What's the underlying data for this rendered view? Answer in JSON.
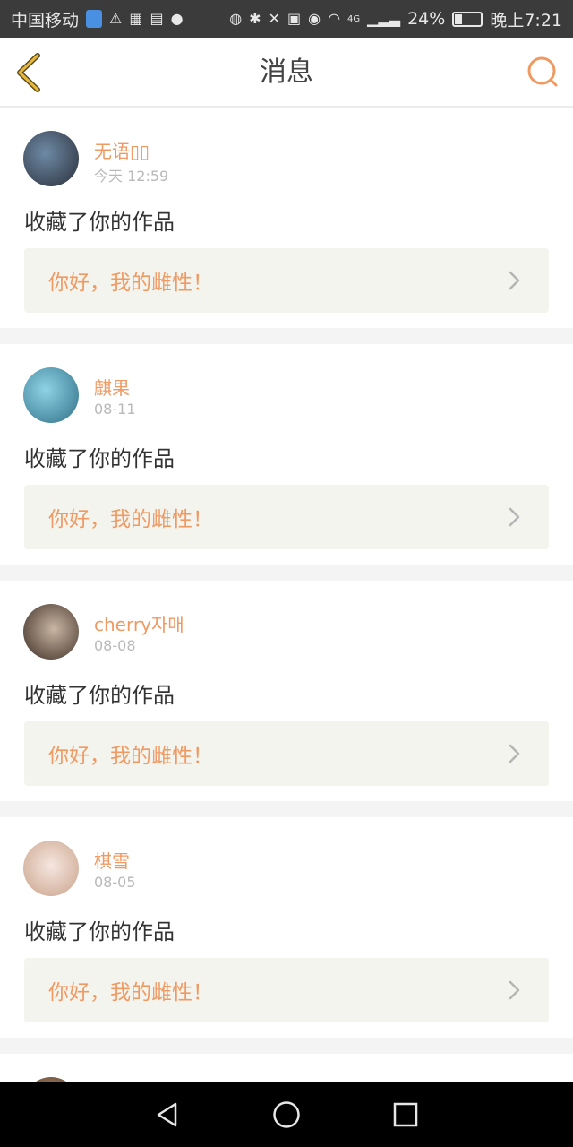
{
  "status_bar": {
    "carrier": "中国移动",
    "battery": "24%",
    "time": "晚上7:21",
    "network": "4G"
  },
  "header": {
    "title": "消息"
  },
  "messages": [
    {
      "name": "无语▯▯",
      "date": "今天 12:59",
      "action": "收藏了你的作品",
      "work_title": "你好，我的雌性！",
      "avatar_colors": [
        "#6e8aa5",
        "#2a2f3a"
      ]
    },
    {
      "name": "麒果",
      "date": "08-11",
      "action": "收藏了你的作品",
      "work_title": "你好，我的雌性！",
      "avatar_colors": [
        "#8fd3e6",
        "#2f6f86"
      ]
    },
    {
      "name": "cherry자매",
      "date": "08-08",
      "action": "收藏了你的作品",
      "work_title": "你好，我的雌性！",
      "avatar_colors": [
        "#c9b6a3",
        "#3a2b22"
      ]
    },
    {
      "name": "棋雪",
      "date": "08-05",
      "action": "收藏了你的作品",
      "work_title": "你好，我的雌性！",
      "avatar_colors": [
        "#f6e6e0",
        "#c9a38a"
      ]
    }
  ],
  "colors": {
    "accent": "#ef9a63",
    "back_icon": "#e8b73a",
    "link_bg": "#f4f4ee"
  }
}
